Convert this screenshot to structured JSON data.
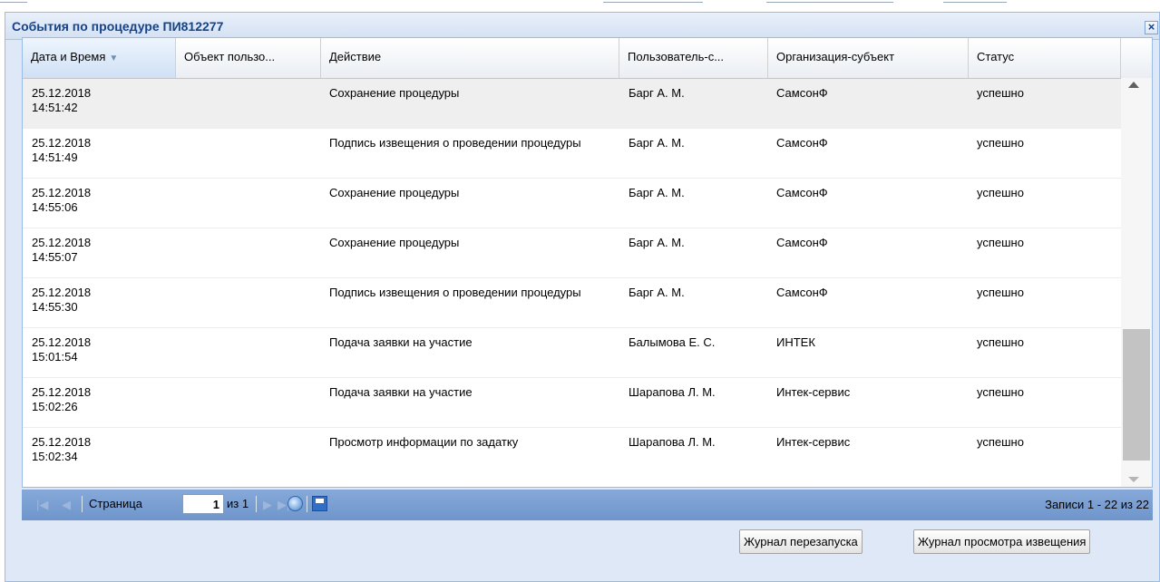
{
  "dialog": {
    "title": "События по процедуре ПИ812277",
    "close_label": "×"
  },
  "columns": [
    {
      "label": "Дата и Время",
      "sorted": true
    },
    {
      "label": "Объект пользо..."
    },
    {
      "label": "Действие"
    },
    {
      "label": "Пользователь-с..."
    },
    {
      "label": "Организация-субъект"
    },
    {
      "label": "Статус"
    }
  ],
  "sort_icon": "sort-desc-icon",
  "rows": [
    {
      "date": "25.12.2018",
      "time": "14:51:42",
      "object": "",
      "action": "Сохранение процедуры",
      "user": "Барг А. М.",
      "org": "СамсонФ",
      "status": "успешно"
    },
    {
      "date": "25.12.2018",
      "time": "14:51:49",
      "object": "",
      "action": "Подпись извещения о проведении процедуры",
      "user": "Барг А. М.",
      "org": "СамсонФ",
      "status": "успешно"
    },
    {
      "date": "25.12.2018",
      "time": "14:55:06",
      "object": "",
      "action": "Сохранение процедуры",
      "user": "Барг А. М.",
      "org": "СамсонФ",
      "status": "успешно"
    },
    {
      "date": "25.12.2018",
      "time": "14:55:07",
      "object": "",
      "action": "Сохранение процедуры",
      "user": "Барг А. М.",
      "org": "СамсонФ",
      "status": "успешно"
    },
    {
      "date": "25.12.2018",
      "time": "14:55:30",
      "object": "",
      "action": "Подпись извещения о проведении процедуры",
      "user": "Барг А. М.",
      "org": "СамсонФ",
      "status": "успешно"
    },
    {
      "date": "25.12.2018",
      "time": "15:01:54",
      "object": "",
      "action": "Подача заявки на участие",
      "user": "Балымова Е. С.",
      "org": "ИНТЕК",
      "status": "успешно"
    },
    {
      "date": "25.12.2018",
      "time": "15:02:26",
      "object": "",
      "action": "Подача заявки на участие",
      "user": "Шарапова Л. М.",
      "org": "Интек-сервис",
      "status": "успешно"
    },
    {
      "date": "25.12.2018",
      "time": "15:02:34",
      "object": "",
      "action": "Просмотр информации по задатку",
      "user": "Шарапова Л. М.",
      "org": "Интек-сервис",
      "status": "успешно"
    }
  ],
  "pager": {
    "page_label": "Страница",
    "page_value": "1",
    "of_label": "из 1",
    "records": "Записи 1 - 22 из 22"
  },
  "buttons": {
    "restart_log": "Журнал перезапуска",
    "view_log": "Журнал просмотра извещения"
  }
}
